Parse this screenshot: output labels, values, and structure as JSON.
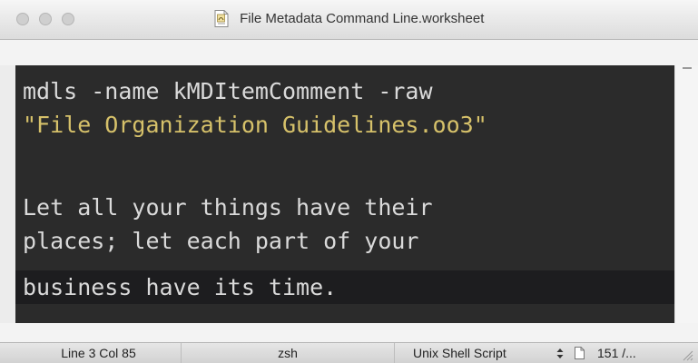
{
  "window": {
    "title": "File Metadata Command Line.worksheet"
  },
  "editor": {
    "lines": [
      {
        "text": "mdls -name kMDItemComment -raw",
        "kind": "command"
      },
      {
        "text": "\"File Organization Guidelines.oo3\"",
        "kind": "string"
      },
      {
        "text": "",
        "kind": "blank"
      },
      {
        "text": "Let all your things have their",
        "kind": "output"
      },
      {
        "text": "places; let each part of your",
        "kind": "output"
      },
      {
        "text": "business have its time.",
        "kind": "output-current"
      }
    ]
  },
  "statusbar": {
    "position": "Line 3 Col 85",
    "shell": "zsh",
    "language": "Unix Shell Script",
    "count": "151 /..."
  },
  "icons": {
    "doc": "worksheet-document-icon",
    "stepper": "up-down-stepper-icon",
    "page": "page-icon",
    "grip": "resize-grip-icon"
  },
  "colors": {
    "editor_bg": "#2b2b2b",
    "current_line_bg": "#1d1d1f",
    "text": "#dadada",
    "string": "#d6c16a"
  }
}
